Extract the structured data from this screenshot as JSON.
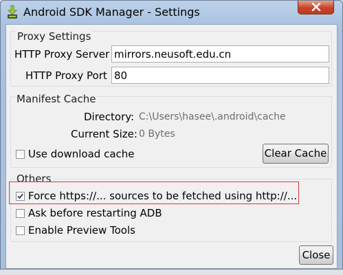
{
  "window": {
    "title": "Android SDK Manager - Settings"
  },
  "proxy": {
    "group_title": "Proxy Settings",
    "server_label": "HTTP Proxy Server",
    "server_value": "mirrors.neusoft.edu.cn",
    "port_label": "HTTP Proxy Port",
    "port_value": "80"
  },
  "manifest": {
    "group_title": "Manifest Cache",
    "directory_label": "Directory:",
    "directory_value": "C:\\Users\\hasee\\.android\\cache",
    "size_label": "Current Size:",
    "size_value": "0 Bytes",
    "use_cache_label": "Use download cache",
    "use_cache_checked": false,
    "clear_cache_label": "Clear Cache"
  },
  "others": {
    "group_title": "Others",
    "force_http_label": "Force https://... sources to be fetched using http://...",
    "force_http_checked": true,
    "ask_restart_label": "Ask before restarting ADB",
    "ask_restart_checked": false,
    "preview_tools_label": "Enable Preview Tools",
    "preview_tools_checked": false
  },
  "footer": {
    "close_label": "Close"
  },
  "icons": {
    "app_icon": "android-sdk-download-icon",
    "title_close": "close-icon",
    "check": "checkmark-icon"
  },
  "colors": {
    "titlebar": "#a8c1df",
    "close_button": "#c7432a",
    "highlight_border": "#d23a3a"
  }
}
